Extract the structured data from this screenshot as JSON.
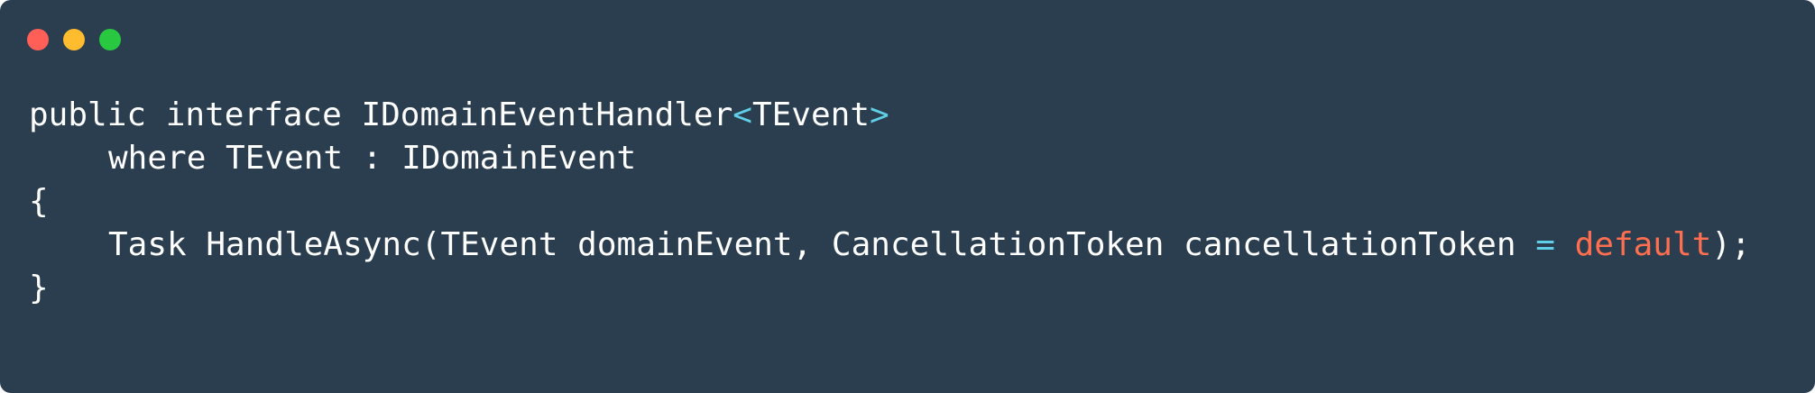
{
  "window": {
    "dots": [
      {
        "name": "close",
        "color": "#ff5f57"
      },
      {
        "name": "minimize",
        "color": "#febc2e"
      },
      {
        "name": "maximize",
        "color": "#28c840"
      }
    ],
    "background": "#2b3e50"
  },
  "code": {
    "line1": {
      "text": "public interface IDomainEventHandler",
      "lt": "<",
      "generic": "TEvent",
      "gt": ">"
    },
    "line2": {
      "text": "where TEvent : IDomainEvent"
    },
    "line3": {
      "text": "{"
    },
    "line4": {
      "text": "Task HandleAsync(TEvent domainEvent, CancellationToken cancellationToken ",
      "eq": "=",
      "space": " ",
      "default_kw": "default",
      "end": ");"
    },
    "line5": {
      "text": "}"
    }
  },
  "colors": {
    "text": "#ffffff",
    "operator": "#5fd0e8",
    "keyword": "#ff6e4e"
  }
}
